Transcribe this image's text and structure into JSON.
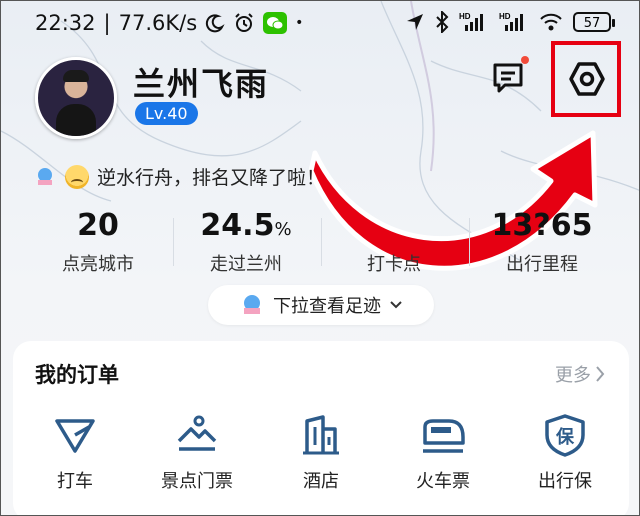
{
  "status_bar": {
    "time": "22:32",
    "speed": "77.6K/s",
    "battery": "57"
  },
  "profile": {
    "username": "兰州飞雨",
    "level": "Lv.40"
  },
  "rank": {
    "text": "逆水行舟，排名又降了啦！"
  },
  "stats": [
    {
      "value": "20",
      "unit": "",
      "label": "点亮城市"
    },
    {
      "value": "24.5",
      "unit": "%",
      "label": "走过兰州"
    },
    {
      "value": "",
      "unit": "",
      "label": "打卡点"
    },
    {
      "value": "13?65",
      "unit": "",
      "label": "出行里程"
    }
  ],
  "pull_hint": "下拉查看足迹",
  "orders": {
    "title": "我的订单",
    "more": "更多",
    "items": [
      {
        "label": "打车",
        "icon": "taxi-icon"
      },
      {
        "label": "景点门票",
        "icon": "scenic-ticket-icon"
      },
      {
        "label": "酒店",
        "icon": "hotel-icon"
      },
      {
        "label": "火车票",
        "icon": "train-icon"
      },
      {
        "label": "出行保",
        "icon": "insurance-icon"
      }
    ]
  },
  "colors": {
    "accent": "#1a76e8",
    "annotation": "#e60012",
    "icon": "#2d5b8a"
  }
}
